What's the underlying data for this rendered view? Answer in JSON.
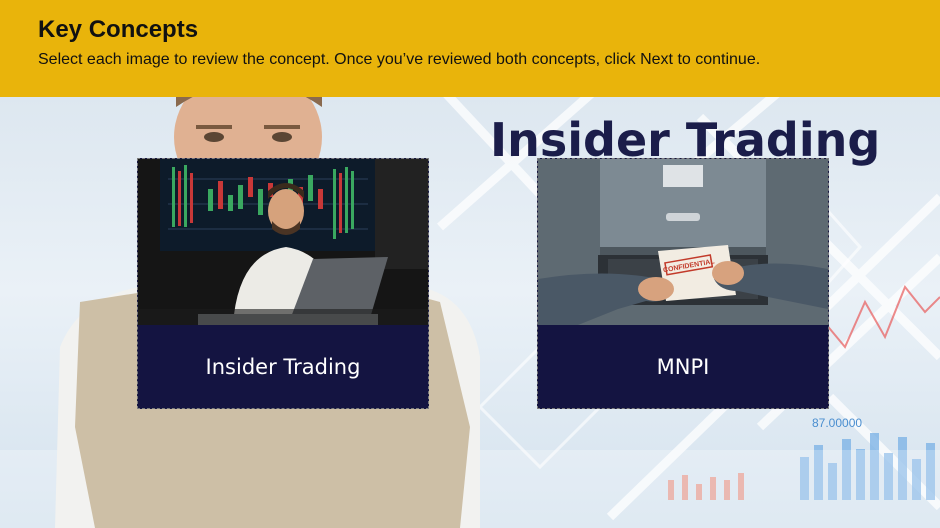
{
  "header": {
    "title": "Key Concepts",
    "instructions": "Select each image to review the concept. Once you’ve reviewed both concepts, click Next to continue."
  },
  "background": {
    "title": "Insider Trading",
    "ticker_values": [
      "87.00000"
    ]
  },
  "cards": [
    {
      "label": "Insider Trading",
      "image": "trader-at-laptop-photo"
    },
    {
      "label": "MNPI",
      "image": "confidential-file-drawer-photo",
      "document_stamp": "CONFIDENTIAL"
    }
  ],
  "colors": {
    "header_bg": "#e9b40b",
    "card_label_bg": "#141441",
    "bg_title": "#1b1d4a"
  }
}
